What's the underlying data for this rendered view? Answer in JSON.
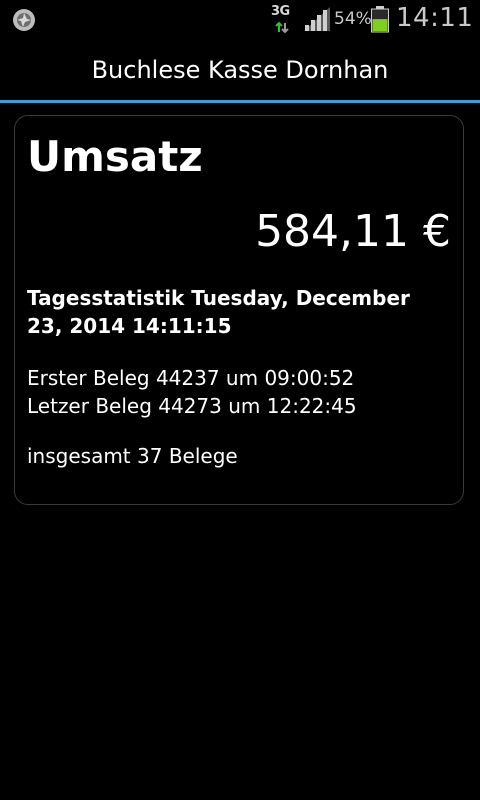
{
  "statusbar": {
    "app_icon": "shutter-icon",
    "network_type": "3G",
    "signal_icon": "signal-bars-icon",
    "battery_percent": "54%",
    "battery_icon": "battery-icon",
    "battery_color": "#7fd01e",
    "time": "14:11"
  },
  "titlebar": {
    "title": "Buchlese Kasse Dornhan",
    "divider_color": "#33a6d8"
  },
  "card": {
    "heading": "Umsatz",
    "amount": "584,11 €",
    "stats_label": "Tagesstatistik Tuesday, December 23, 2014 14:11:15",
    "first_receipt": "Erster Beleg 44237 um 09:00:52",
    "last_receipt": "Letzer Beleg 44273 um 12:22:45",
    "total": "insgesamt 37 Belege"
  }
}
